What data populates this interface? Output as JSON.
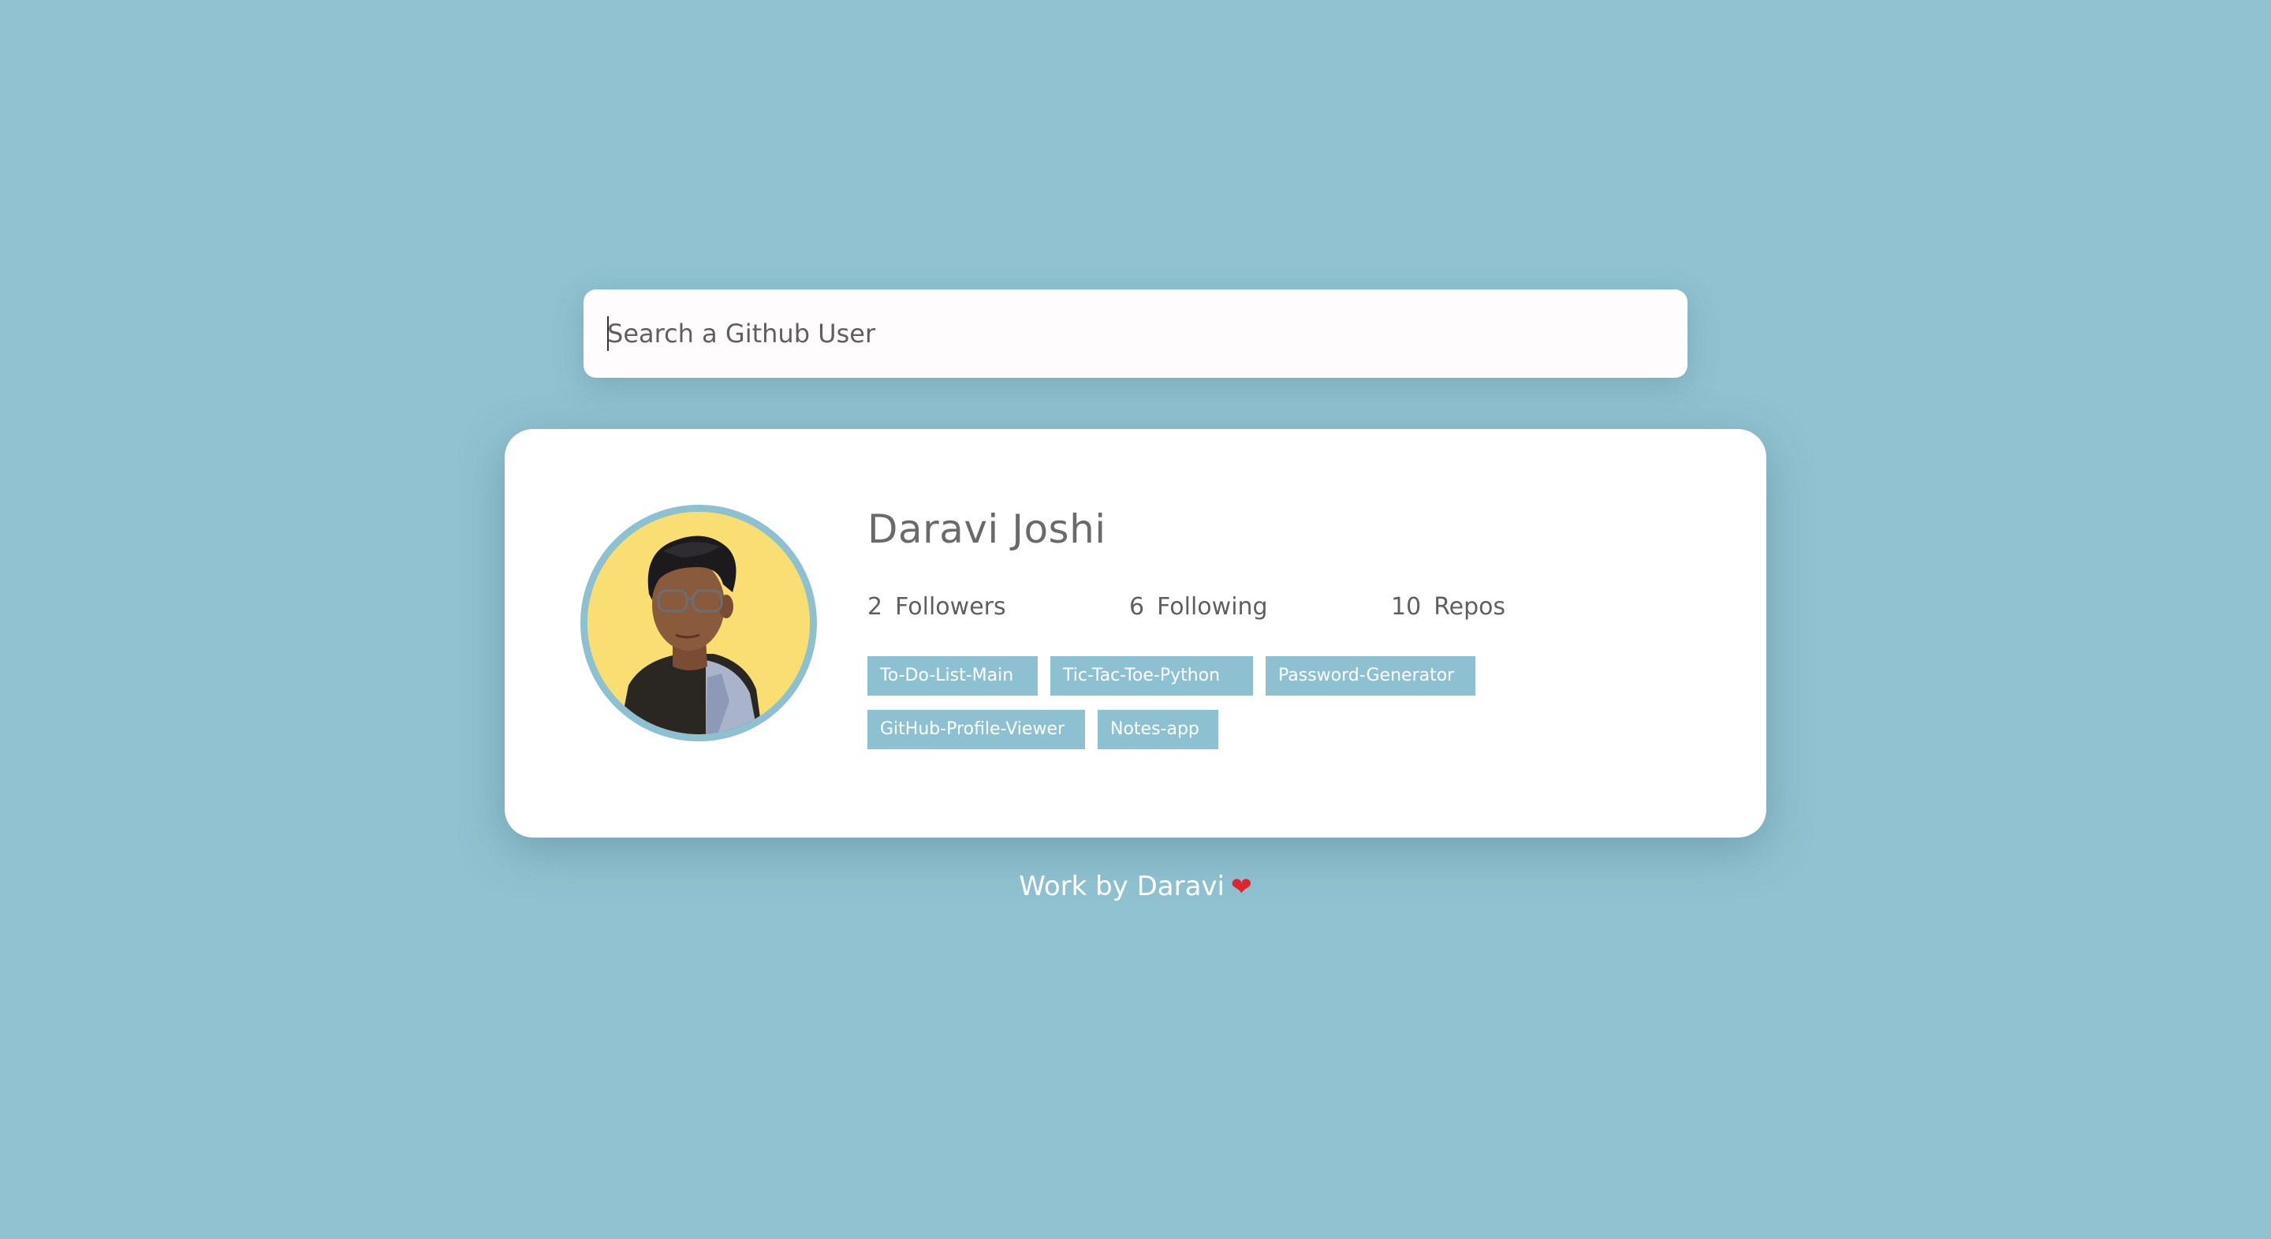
{
  "search": {
    "placeholder": "Search a Github User",
    "value": ""
  },
  "profile": {
    "name": "Daravi Joshi",
    "avatar_alt": "Daravi Joshi avatar",
    "stats": {
      "followers_count": "2",
      "followers_label": "Followers",
      "following_count": "6",
      "following_label": "Following",
      "repos_count": "10",
      "repos_label": "Repos"
    },
    "repos": [
      "To-Do-List-Main",
      "Tic-Tac-Toe-Python",
      "Password-Generator",
      "GitHub-Profile-Viewer",
      "Notes-app"
    ]
  },
  "footer": {
    "text": "Work by Daravi",
    "heart_icon": "heart-icon"
  },
  "colors": {
    "background": "#90c2d1",
    "accent": "#8dc1d1",
    "avatar_bg": "#f9df72",
    "card": "#ffffff",
    "heart": "#e0262b"
  }
}
